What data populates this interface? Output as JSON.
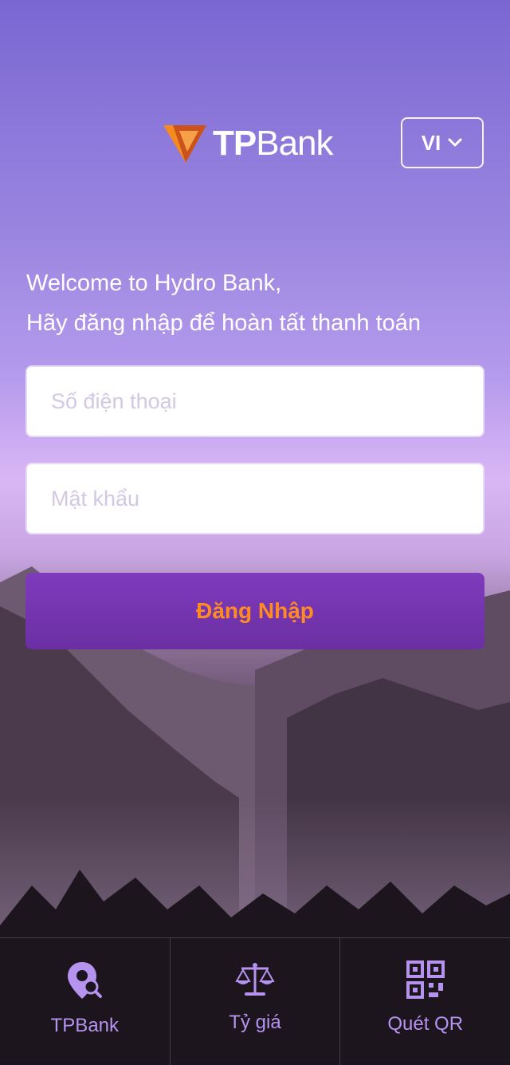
{
  "header": {
    "brand": {
      "part_bold": "TP",
      "part_light": "Bank"
    },
    "language": {
      "label": "VI",
      "icon": "chevron-down-icon"
    }
  },
  "welcome": {
    "line1": "Welcome to Hydro Bank,",
    "line2": "Hãy đăng nhập để hoàn tất thanh toán"
  },
  "form": {
    "phone_placeholder": "Số điện thoại",
    "password_placeholder": "Mật khẩu",
    "login_label": "Đăng Nhập"
  },
  "bottom_nav": {
    "items": [
      {
        "label": "TPBank",
        "icon": "location-search-icon"
      },
      {
        "label": "Tỷ giá",
        "icon": "scale-icon"
      },
      {
        "label": "Quét QR",
        "icon": "qr-code-icon"
      }
    ]
  },
  "colors": {
    "accent_orange": "#ff8c22",
    "button_purple": "#6b2fa3",
    "nav_icon": "#b793f0"
  }
}
